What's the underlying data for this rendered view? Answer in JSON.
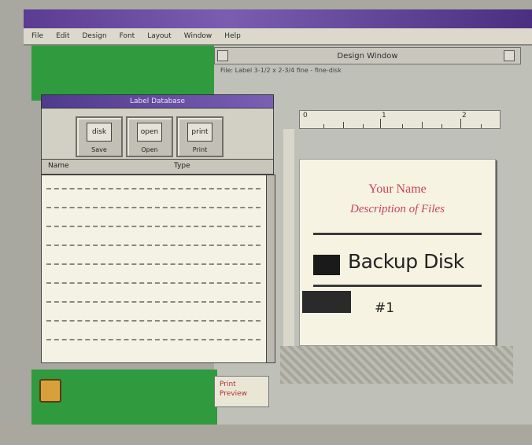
{
  "outer_window": {
    "menu": [
      "File",
      "Edit",
      "Design",
      "Font",
      "Layout",
      "Window",
      "Help"
    ]
  },
  "design_window": {
    "title": "Design Window",
    "status": "File: Label 3-1/2 x 2-3/4 fine - fine-disk",
    "ruler_numbers": [
      "0",
      "1",
      "2"
    ]
  },
  "label": {
    "your_name": "Your Name",
    "description": "Description of Files",
    "backup_text": "Backup Disk",
    "number": "#1"
  },
  "note": {
    "line1": "Print",
    "line2": "Preview"
  },
  "list_window": {
    "title": "Label Database",
    "toolbar": [
      {
        "icon": "disk",
        "label": "Save"
      },
      {
        "icon": "open",
        "label": "Open"
      },
      {
        "icon": "print",
        "label": "Print"
      }
    ],
    "columns": [
      "Name",
      "Type"
    ],
    "row_count": 9
  }
}
